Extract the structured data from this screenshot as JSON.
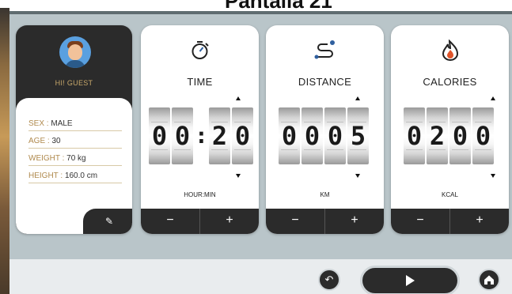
{
  "page": {
    "title": "Pantalla 21"
  },
  "profile": {
    "greeting": "HI! GUEST",
    "sex": {
      "key": "SEX :",
      "value": "MALE"
    },
    "age": {
      "key": "AGE :",
      "value": "30"
    },
    "weight": {
      "key": "WEIGHT :",
      "value": "70 kg"
    },
    "height": {
      "key": "HEIGHT :",
      "value": "160.0 cm"
    },
    "edit_icon": "pencil-icon"
  },
  "metrics": {
    "time": {
      "label": "TIME",
      "icon": "stopwatch-icon",
      "digits": [
        "0",
        "0",
        ":",
        "2",
        "0"
      ],
      "unit": "HOUR:MIN"
    },
    "distance": {
      "label": "DISTANCE",
      "icon": "route-icon",
      "digits": [
        "0",
        "0",
        "0",
        "5"
      ],
      "unit": "KM"
    },
    "calories": {
      "label": "CALORIES",
      "icon": "flame-icon",
      "digits": [
        "0",
        "2",
        "0",
        "0"
      ],
      "unit": "KCAL"
    }
  },
  "stepper": {
    "minus": "−",
    "plus": "+"
  },
  "controls": {
    "back_icon": "undo-icon",
    "start_icon": "play-icon",
    "home_icon": "home-icon"
  },
  "colors": {
    "accent_gold": "#c9a96b",
    "dark": "#2b2b2b",
    "screen_bg": "#b9c5c9",
    "icon_blue": "#2f5f9e",
    "flame_red": "#e0542a"
  }
}
